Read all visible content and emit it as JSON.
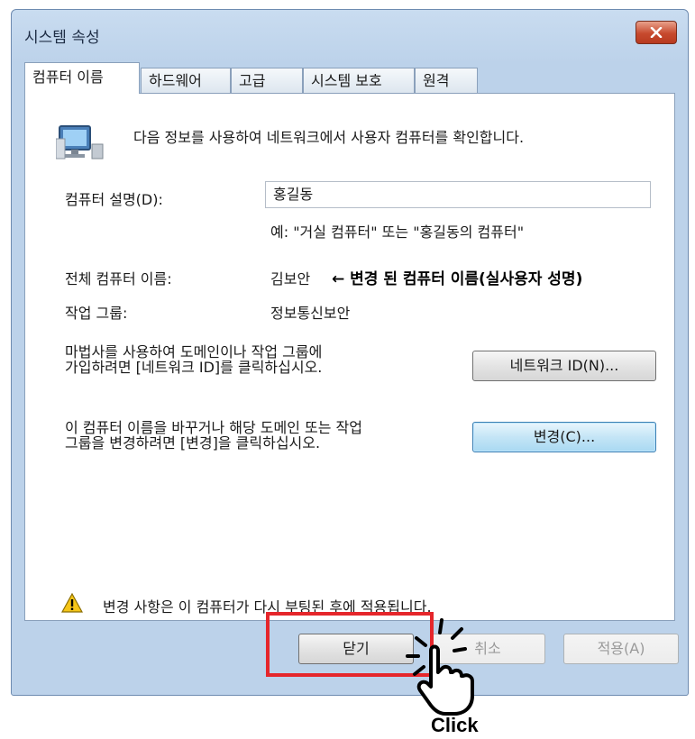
{
  "window": {
    "title": "시스템 속성"
  },
  "tabs": [
    {
      "label": "컴퓨터 이름",
      "active": true
    },
    {
      "label": "하드웨어",
      "active": false
    },
    {
      "label": "고급",
      "active": false
    },
    {
      "label": "시스템 보호",
      "active": false
    },
    {
      "label": "원격",
      "active": false
    }
  ],
  "intro": {
    "icon": "computer-network-icon",
    "text": "다음 정보를 사용하여 네트워크에서 사용자 컴퓨터를 확인합니다."
  },
  "description": {
    "label": "컴퓨터 설명(D):",
    "value": "홍길동",
    "hint": "예: \"거실 컴퓨터\" 또는 \"홍길동의 컴퓨터\""
  },
  "full_name": {
    "label": "전체 컴퓨터 이름:",
    "value": "김보안",
    "annotation": "← 변경 된 컴퓨터 이름(실사용자 성명)"
  },
  "workgroup": {
    "label": "작업 그룹:",
    "value": "정보통신보안"
  },
  "network_id": {
    "text_line1": "마법사를 사용하여 도메인이나 작업 그룹에",
    "text_line2": "가입하려면 [네트워크 ID]를 클릭하십시오.",
    "button": "네트워크 ID(N)..."
  },
  "change": {
    "text_line1": "이 컴퓨터 이름을 바꾸거나 해당 도메인 또는 작업",
    "text_line2": "그룹을 변경하려면 [변경]을 클릭하십시오.",
    "button": "변경(C)..."
  },
  "warning": {
    "icon": "warning-icon",
    "text": "변경 사항은 이 컴퓨터가 다시 부팅된 후에 적용됩니다."
  },
  "footer": {
    "close": "닫기",
    "cancel": "취소",
    "apply": "적용(A)"
  },
  "overlay": {
    "click_label": "Click",
    "highlight_color": "#e5262b"
  }
}
